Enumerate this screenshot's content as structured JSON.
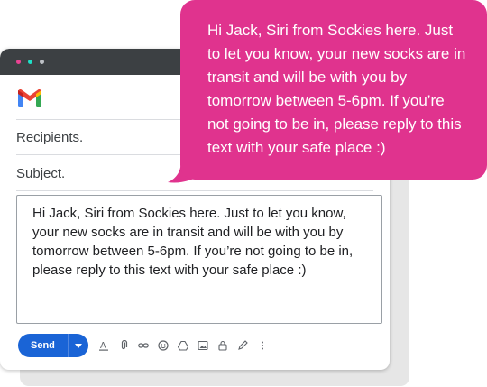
{
  "colors": {
    "accent_pink": "#e0338e",
    "send_blue": "#1a64d6",
    "titlebar": "#3c4043"
  },
  "compose": {
    "recipients_placeholder": "Recipients.",
    "subject_placeholder": "Subject.",
    "body_text": "Hi Jack, Siri from Sockies here. Just to let you know, your new socks are in transit and will be with you by tomorrow between 5-6pm. If you’re not going to be in, please reply to this text with your safe place :)"
  },
  "toolbar": {
    "send_label": "Send",
    "icons": [
      "text-format-icon",
      "attach-icon",
      "link-icon",
      "emoji-icon",
      "drive-icon",
      "image-icon",
      "lock-icon",
      "pen-icon",
      "more-icon"
    ]
  },
  "bubble": {
    "text": "Hi Jack, Siri from Sockies here. Just to let you know, your new socks are in transit and will be with you by tomorrow between 5-6pm. If you’re not going to be in, please reply to this text with your safe place :)"
  }
}
